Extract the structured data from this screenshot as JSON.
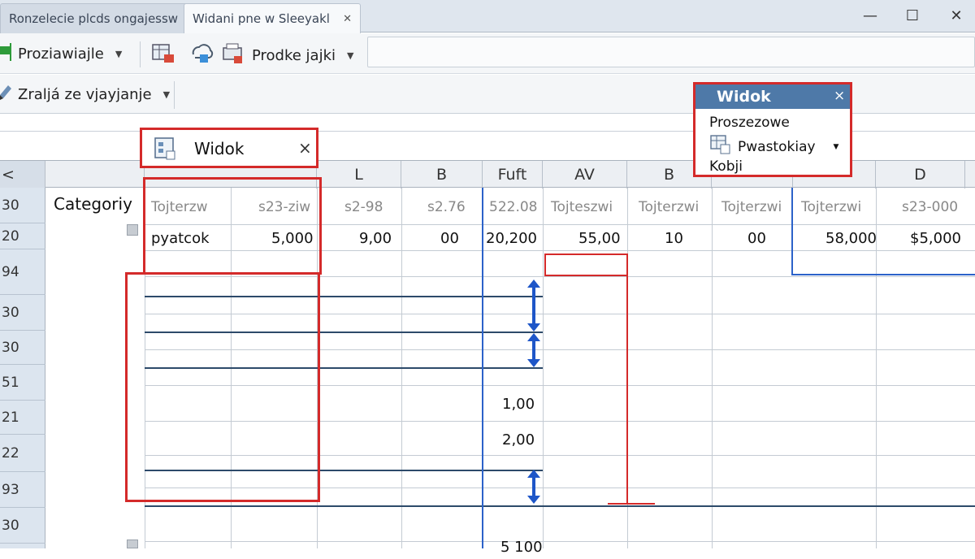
{
  "tabs": {
    "tab1": "Ronzelecie plcds ongajessw",
    "tab2": "Widani pne w Sleeyakl",
    "tab2_close": "✕"
  },
  "window": {
    "minimize": "—",
    "maximize": "☐",
    "close": "✕"
  },
  "toolbar1": {
    "view_button": "Proziawiajle",
    "product_button": "Prodke jajki"
  },
  "toolbar2": {
    "items_button": "Zraljá ze vjayjanje"
  },
  "widok_tab": {
    "title": "Widok",
    "close": "×"
  },
  "widok_panel": {
    "title": "Widok",
    "close": "×",
    "items": [
      "Proszezowe",
      "Pwastokiay",
      "Kobji"
    ]
  },
  "columns": {
    "corner": "<",
    "headers": [
      "",
      "",
      "L",
      "B",
      "Fuft",
      "AV",
      "B",
      "",
      "",
      "D"
    ]
  },
  "row_numbers": [
    "30",
    "20",
    "94",
    "30",
    "30",
    "51",
    "21",
    "22",
    "93",
    "30"
  ],
  "sidebar": {
    "category_label": "Categoriy"
  },
  "header_row": [
    "Tojterzw",
    "s23-ziw",
    "s2-98",
    "s2.76",
    "522.08",
    "Tojteszwi",
    "Tojterzwi",
    "Tojterzwi",
    "Tojterzwi",
    "s23-000"
  ],
  "data_row": {
    "label": "pyatcok",
    "values": [
      "5,000",
      "9,00",
      "00",
      "20,200",
      "55,00",
      "10",
      "00",
      "58,000",
      "$5,000"
    ]
  },
  "lower_values": [
    "1,00",
    "2,00",
    "5 100"
  ],
  "colors": {
    "highlight": "#d42a2a",
    "accent": "#2c62c9",
    "panel_header": "#4e79a8"
  }
}
